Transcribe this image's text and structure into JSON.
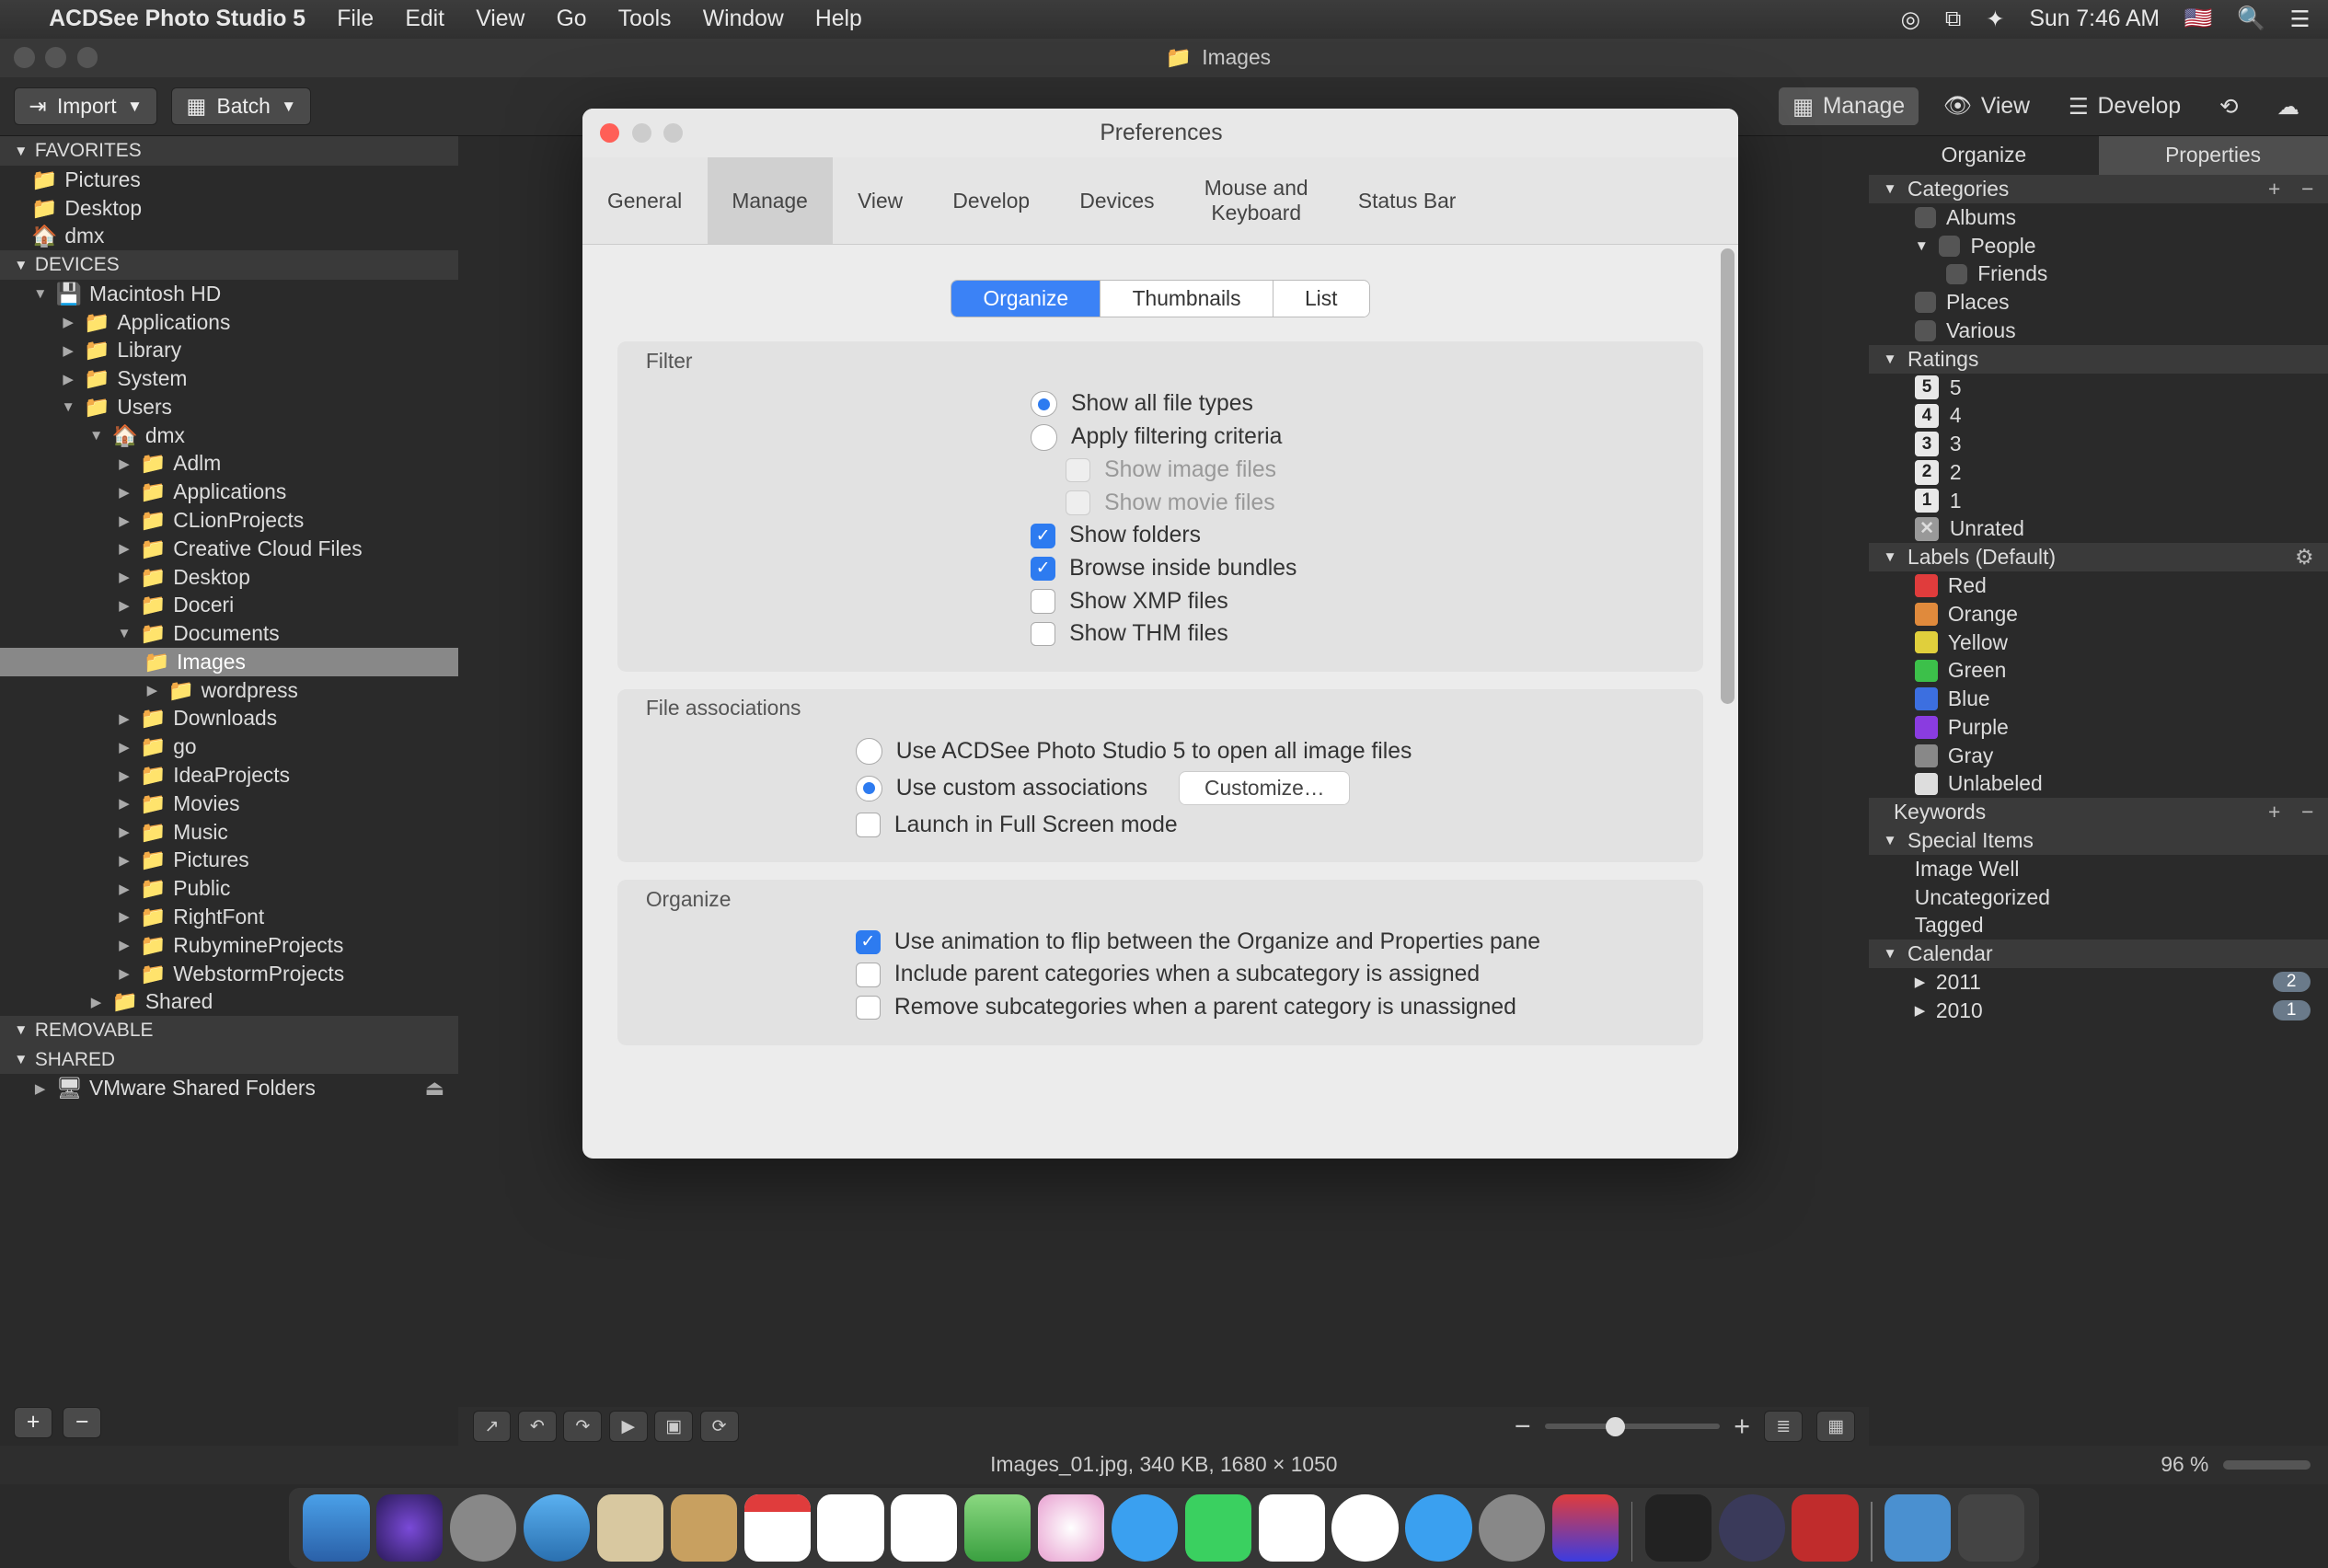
{
  "menubar": {
    "app_name": "ACDSee Photo Studio 5",
    "items": [
      "File",
      "Edit",
      "View",
      "Go",
      "Tools",
      "Window",
      "Help"
    ],
    "clock": "Sun 7:46 AM"
  },
  "titlebar": {
    "breadcrumb": "Images"
  },
  "toolbar": {
    "import_label": "Import",
    "batch_label": "Batch",
    "modes": {
      "manage": "Manage",
      "view": "View",
      "develop": "Develop"
    }
  },
  "left": {
    "sections": {
      "favorites": "FAVORITES",
      "devices": "DEVICES",
      "removable": "REMOVABLE",
      "shared": "SHARED"
    },
    "fav_items": [
      "Pictures",
      "Desktop",
      "dmx"
    ],
    "device_root": "Macintosh HD",
    "mac_children": [
      "Applications",
      "Library",
      "System",
      "Users"
    ],
    "user": "dmx",
    "user_children_top": [
      "Adlm",
      "Applications",
      "CLionProjects",
      "Creative Cloud Files",
      "Desktop",
      "Doceri",
      "Documents"
    ],
    "doc_children": [
      "Images",
      "wordpress"
    ],
    "user_children_bottom": [
      "Downloads",
      "go",
      "IdeaProjects",
      "Movies",
      "Music",
      "Pictures",
      "Public",
      "RightFont",
      "RubymineProjects",
      "WebstormProjects"
    ],
    "mac_shared": "Shared",
    "shared_item": "VMware Shared Folders"
  },
  "thumb_toolbar": {},
  "right": {
    "tabs": {
      "organize": "Organize",
      "properties": "Properties"
    },
    "categories_hdr": "Categories",
    "categories": [
      "Albums",
      "People",
      "Friends",
      "Places",
      "Various"
    ],
    "ratings_hdr": "Ratings",
    "ratings": [
      "5",
      "4",
      "3",
      "2",
      "1",
      "Unrated"
    ],
    "labels_hdr": "Labels (Default)",
    "labels": [
      {
        "name": "Red",
        "color": "#e03c3c"
      },
      {
        "name": "Orange",
        "color": "#e08a3c"
      },
      {
        "name": "Yellow",
        "color": "#e0cf3c"
      },
      {
        "name": "Green",
        "color": "#3cc04a"
      },
      {
        "name": "Blue",
        "color": "#3c6fe0"
      },
      {
        "name": "Purple",
        "color": "#8a3ce0"
      },
      {
        "name": "Gray",
        "color": "#888"
      },
      {
        "name": "Unlabeled",
        "color": "#ddd"
      }
    ],
    "keywords_hdr": "Keywords",
    "special_hdr": "Special Items",
    "special_items": [
      "Image Well",
      "Uncategorized",
      "Tagged"
    ],
    "calendar_hdr": "Calendar",
    "calendar": [
      {
        "year": "2011",
        "count": "2"
      },
      {
        "year": "2010",
        "count": "1"
      }
    ]
  },
  "status": {
    "text": "Images_01.jpg, 340 KB, 1680 × 1050",
    "pct": "96 %"
  },
  "pref": {
    "title": "Preferences",
    "tabs": [
      "General",
      "Manage",
      "View",
      "Develop",
      "Devices",
      "Mouse and Keyboard",
      "Status Bar"
    ],
    "active_tab": "Manage",
    "segments": [
      "Organize",
      "Thumbnails",
      "List"
    ],
    "active_segment": "Organize",
    "filter_title": "Filter",
    "filter": {
      "show_all": "Show all file types",
      "apply_filter": "Apply filtering criteria",
      "show_image": "Show image files",
      "show_movie": "Show movie files",
      "show_folders": "Show folders",
      "browse_bundles": "Browse inside bundles",
      "show_xmp": "Show XMP files",
      "show_thm": "Show THM files"
    },
    "file_assoc_title": "File associations",
    "file_assoc": {
      "use_acdsee": "Use ACDSee Photo Studio 5 to open all image files",
      "use_custom": "Use custom associations",
      "customize_btn": "Customize…",
      "fullscreen": "Launch in Full Screen mode"
    },
    "organize_title": "Organize",
    "organize": {
      "animation": "Use animation to flip between the Organize and Properties pane",
      "include_parent": "Include parent categories when a subcategory is assigned",
      "remove_sub": "Remove subcategories when a parent category is unassigned"
    }
  }
}
